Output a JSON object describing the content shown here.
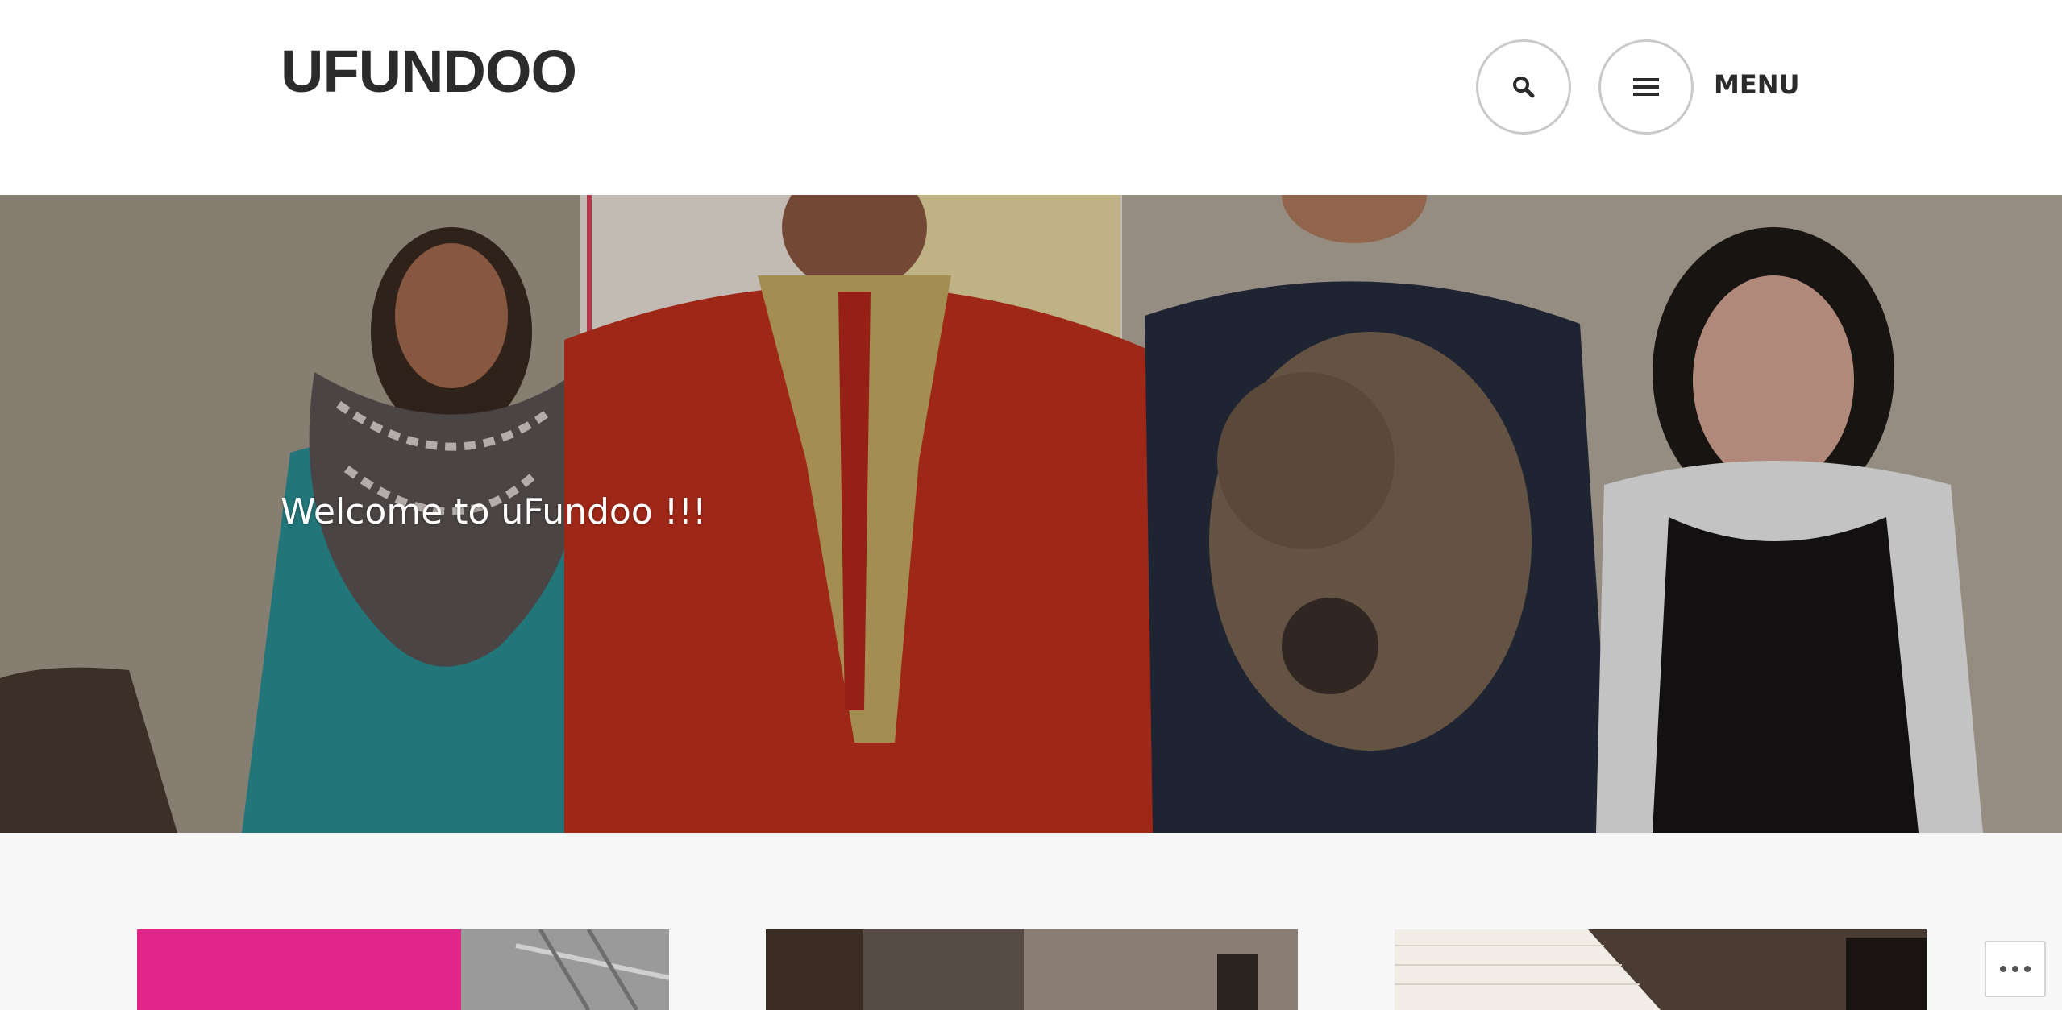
{
  "header": {
    "site_title": "UFUNDOO",
    "menu_label": "MENU",
    "search_icon": "search-icon",
    "menu_icon": "hamburger-icon"
  },
  "hero": {
    "welcome_text": "Welcome to uFundoo !!!"
  },
  "widget": {
    "more_icon": "ellipsis-icon"
  },
  "colors": {
    "header_bg": "#ffffff",
    "title_text": "#2b2b2b",
    "button_border": "#c9c9c9",
    "page_bg": "#f7f7f7",
    "card_pink": "#e0268a"
  }
}
